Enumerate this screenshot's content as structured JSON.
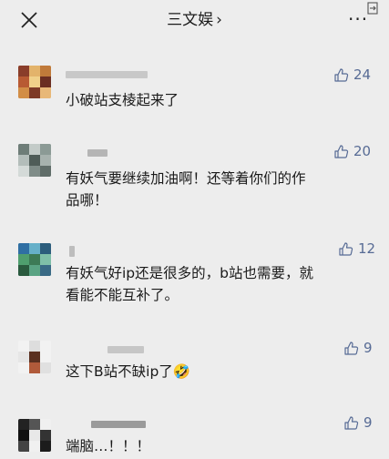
{
  "header": {
    "title": "三文娱",
    "chevron": "›",
    "more": "···"
  },
  "comments": [
    {
      "text": "小破站支棱起来了",
      "likes": "24"
    },
    {
      "text": "有妖气要继续加油啊！还等着你们的作\n品哪！",
      "likes": "20"
    },
    {
      "text": "有妖气好ip还是很多的，b站也需要，就\n看能不能互补了。",
      "likes": "12"
    },
    {
      "text": "这下B站不缺ip了",
      "likes": "9",
      "emoji": "🤣"
    },
    {
      "text": "端脑…！！！",
      "likes": "9"
    }
  ],
  "colors": {
    "background": "#ededed",
    "like_blue": "#576b95"
  }
}
